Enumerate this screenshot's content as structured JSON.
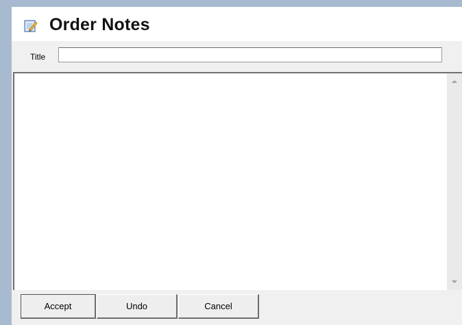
{
  "dialog": {
    "title": "Order Notes",
    "header_icon": "notepad-pencil-icon"
  },
  "form": {
    "title_label": "Title",
    "title_value": "",
    "notes_value": ""
  },
  "buttons": {
    "accept": "Accept",
    "undo": "Undo",
    "cancel": "Cancel"
  },
  "colors": {
    "frame": "#a7bad0",
    "background": "#f0f0f0"
  }
}
